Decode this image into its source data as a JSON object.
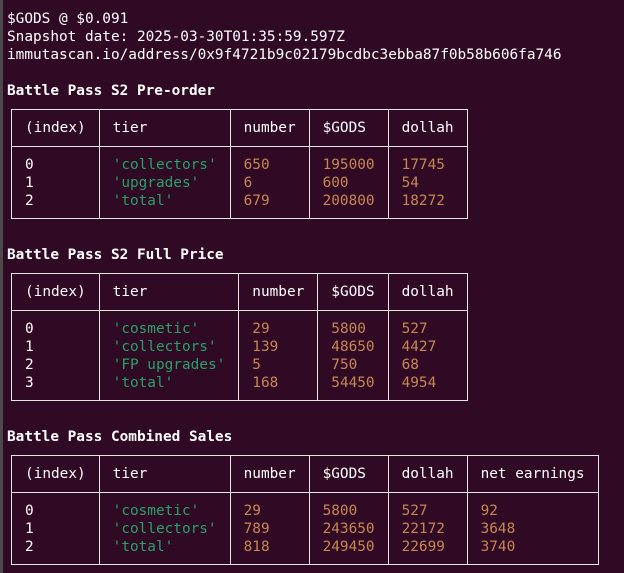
{
  "header": {
    "price_line": "$GODS @ $0.091",
    "snapshot_line": "Snapshot date: 2025-03-30T01:35:59.597Z",
    "address_line": "immutascan.io/address/0x9f4721b9c02179bcdbc3ebba87f0b58b606fa746"
  },
  "colors": {
    "background": "#300a24",
    "text": "#ffffff",
    "string_value": "#26a269",
    "number_value": "#c88752",
    "table_border": "#e6e6e6"
  },
  "preorder": {
    "title": "Battle Pass S2 Pre-order",
    "columns": [
      "(index)",
      "tier",
      "number",
      "$GODS",
      "dollah"
    ],
    "rows": [
      [
        "0",
        "'collectors'",
        "650",
        "195000",
        "17745"
      ],
      [
        "1",
        "'upgrades'",
        "6",
        "600",
        "54"
      ],
      [
        "2",
        "'total'",
        "679",
        "200800",
        "18272"
      ]
    ]
  },
  "fullprice": {
    "title": "Battle Pass S2 Full Price",
    "columns": [
      "(index)",
      "tier",
      "number",
      "$GODS",
      "dollah"
    ],
    "rows": [
      [
        "0",
        "'cosmetic'",
        "29",
        "5800",
        "527"
      ],
      [
        "1",
        "'collectors'",
        "139",
        "48650",
        "4427"
      ],
      [
        "2",
        "'FP upgrades'",
        "5",
        "750",
        "68"
      ],
      [
        "3",
        "'total'",
        "168",
        "54450",
        "4954"
      ]
    ]
  },
  "combined": {
    "title": "Battle Pass Combined Sales",
    "columns": [
      "(index)",
      "tier",
      "number",
      "$GODS",
      "dollah",
      "net earnings"
    ],
    "rows": [
      [
        "0",
        "'cosmetic'",
        "29",
        "5800",
        "527",
        "92"
      ],
      [
        "1",
        "'collectors'",
        "789",
        "243650",
        "22172",
        "3648"
      ],
      [
        "2",
        "'total'",
        "818",
        "249450",
        "22699",
        "3740"
      ]
    ]
  }
}
